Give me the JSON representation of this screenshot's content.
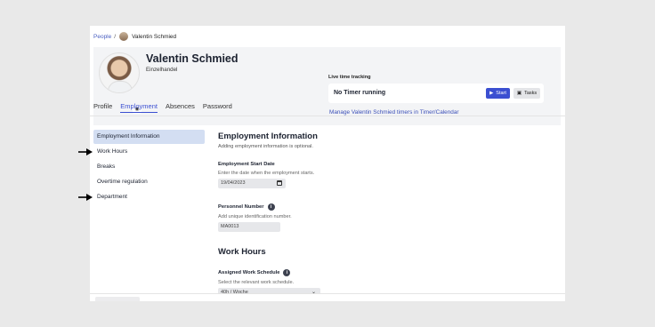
{
  "breadcrumb": {
    "parent": "People",
    "separator": "/",
    "current": "Valentin Schmied"
  },
  "profile": {
    "name": "Valentin Schmied",
    "department": "Einzelhandel"
  },
  "time_tracking": {
    "label": "Live time tracking",
    "status": "No Timer running",
    "start_label": "Start",
    "tasks_label": "Tasks",
    "manage_link": "Manage Valentin Schmied timers in Timer/Calendar"
  },
  "tabs": [
    "Profile",
    "Employment",
    "Absences",
    "Password"
  ],
  "active_tab": "Employment",
  "sidenav": [
    "Employment Information",
    "Work Hours",
    "Breaks",
    "Overtime regulation",
    "Department"
  ],
  "employment": {
    "title": "Employment Information",
    "description": "Adding employment information is optional.",
    "start_date": {
      "label": "Employment Start Date",
      "help": "Enter the date when the employment starts.",
      "value": "19/04/2023"
    },
    "personnel_number": {
      "label": "Personnel Number",
      "help": "Add unique identification number.",
      "value": "MA0013"
    }
  },
  "work_hours": {
    "title": "Work Hours",
    "schedule": {
      "label": "Assigned Work Schedule",
      "help": "Select the relevant work schedule.",
      "value": "40h / Woche"
    }
  },
  "colors": {
    "accent": "#3b4fd1",
    "active_nav": "#d3def2",
    "header_bg": "#f3f4f6"
  },
  "icons": [
    "camera-icon",
    "play-icon",
    "tasks-icon",
    "calendar-icon",
    "info-icon",
    "chevron-down-icon",
    "arrow-right-icon"
  ]
}
